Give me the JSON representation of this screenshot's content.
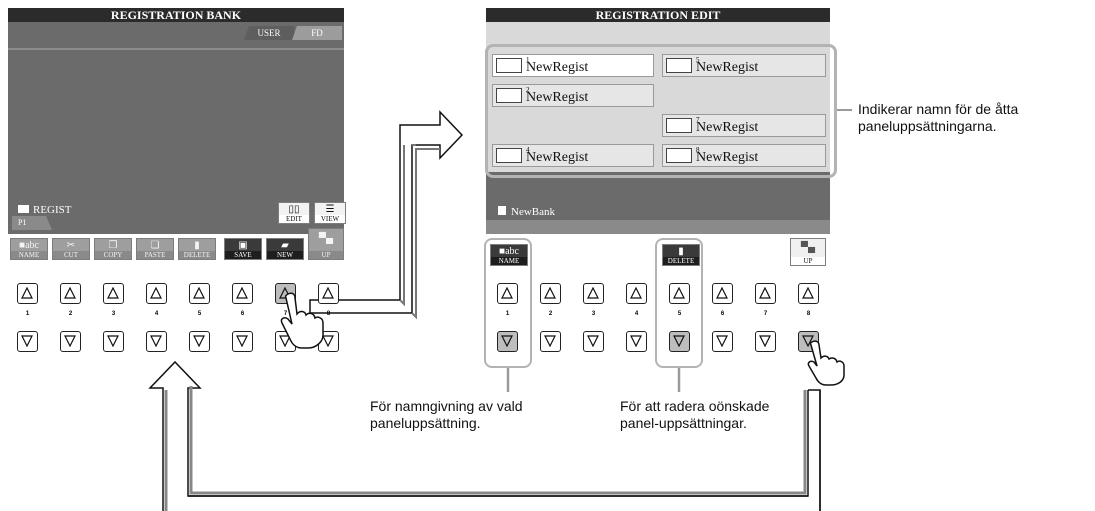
{
  "left_screen": {
    "title": "REGISTRATION BANK",
    "tabs": [
      "USER",
      "FD"
    ],
    "folder": "REGIST",
    "page": "P1",
    "top_buttons": [
      "EDIT",
      "VIEW"
    ],
    "soft_buttons": [
      "NAME",
      "CUT",
      "COPY",
      "PASTE",
      "DELETE",
      "SAVE",
      "NEW",
      "UP"
    ]
  },
  "right_screen": {
    "title": "REGISTRATION EDIT",
    "registrations": [
      {
        "num": "1",
        "name": "NewRegist"
      },
      {
        "num": "5",
        "name": "NewRegist"
      },
      {
        "num": "2",
        "name": "NewRegist"
      },
      {
        "num": "7",
        "name": "NewRegist"
      },
      {
        "num": "4",
        "name": "NewRegist"
      },
      {
        "num": "8",
        "name": "NewRegist"
      }
    ],
    "bank": "NewBank",
    "soft_buttons": [
      "NAME",
      "DELETE",
      "UP"
    ]
  },
  "button_numbers": [
    "1",
    "2",
    "3",
    "4",
    "5",
    "6",
    "7",
    "8"
  ],
  "callouts": {
    "names": "Indikerar namn för de åtta paneluppsättningarna.",
    "naming": "För namngivning av vald paneluppsättning.",
    "deleting": "För att radera oönskade panel-uppsättningar."
  }
}
